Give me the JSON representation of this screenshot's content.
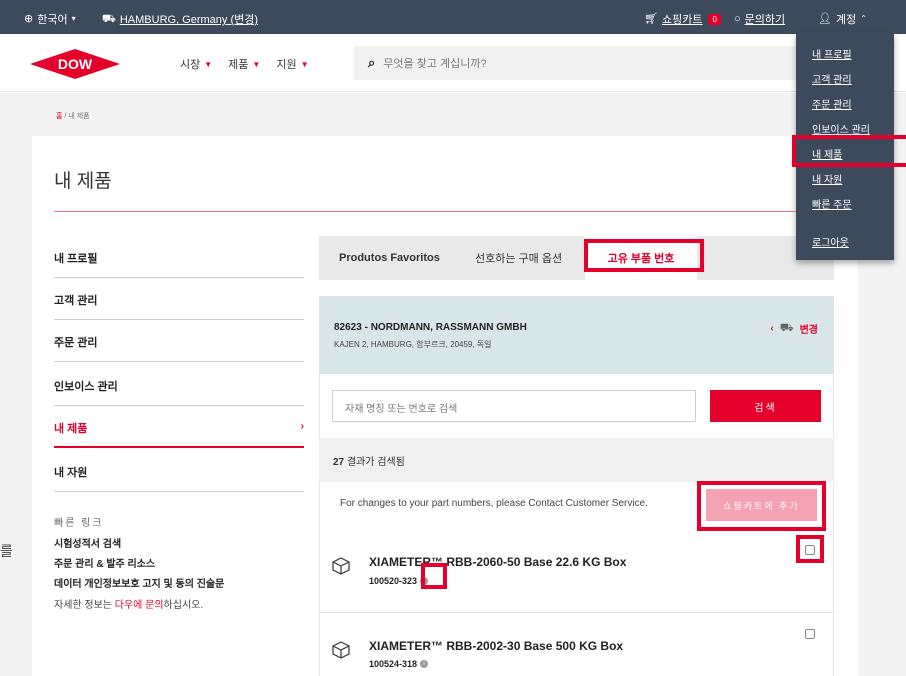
{
  "topbar": {
    "language": "한국어",
    "location_label": "HAMBURG, Germany (변경)",
    "cart_label": "쇼핑카트",
    "cart_count": "0",
    "contact_label": "문의하기",
    "account_label": "계정"
  },
  "header": {
    "logo_text": "DOW",
    "nav": [
      "시장",
      "제품",
      "지원"
    ],
    "search_placeholder": "무엇을 찾고 계십니까?"
  },
  "breadcrumb": {
    "home": "홈",
    "separator": "/",
    "current": "내 제품"
  },
  "page": {
    "title": "내 제품"
  },
  "sidebar": {
    "items": [
      {
        "label": "내 프로필"
      },
      {
        "label": "고객 관리"
      },
      {
        "label": "주문 관리"
      },
      {
        "label": "인보이스 관리"
      },
      {
        "label": "내 제품",
        "active": true
      },
      {
        "label": "내 자원"
      }
    ],
    "quick_title": "빠른 링크",
    "quick_links": [
      "시험성적서 검색",
      "주문 관리 & 발주 리소스",
      "데이터 개인정보보호 고지 및 동의 진술문"
    ],
    "more_prefix": "자세한 정보는 ",
    "more_link": "다우에 문의",
    "more_suffix": "하십시오."
  },
  "stray_glyph": "를",
  "tabs": [
    "Produtos Favoritos",
    "선호하는 구매 옵션",
    "고유 부품 번호"
  ],
  "customer": {
    "name": "82623 - NORDMANN, RASSMANN GMBH",
    "address": "KAJEN 2, HAMBURG, 함부르크, 20459, 독일",
    "change_label": "변경"
  },
  "search": {
    "placeholder": "자재 명칭 또는 번호로 검색",
    "button": "검색"
  },
  "results": {
    "count": "27",
    "text": " 결과가 검색됨"
  },
  "notice": "For changes to your part numbers, please Contact Customer Service.",
  "add_to_cart": "쇼핑카트에 추가",
  "products": [
    {
      "name": "XIAMETER™ RBB-2060-50 Base 22.6 KG Box",
      "code": "100520-323"
    },
    {
      "name": "XIAMETER™ RBB-2002-30 Base 500 KG Box",
      "code": "100524-318"
    }
  ],
  "account_menu": [
    "내 프로필",
    "고객 관리",
    "주문 관리",
    "인보이스 관리",
    "내 제품",
    "내 자원",
    "빠른 주문",
    "로그아웃"
  ],
  "colors": {
    "brand_red": "#e4002b",
    "topbar": "#3d4a5c",
    "customer_bg": "#d9e6e9"
  }
}
